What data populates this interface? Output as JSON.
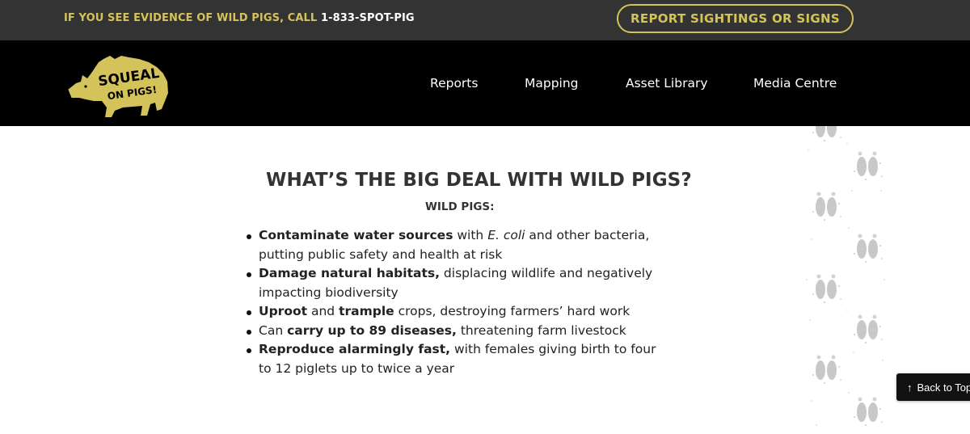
{
  "colors": {
    "accent": "#d4c35a",
    "topbar_bg": "#333333",
    "nav_bg": "#000000"
  },
  "topbar": {
    "alert_text": "IF YOU SEE EVIDENCE OF WILD PIGS, CALL ",
    "phone": "1-833-SPOT-PIG",
    "report_button": "REPORT SIGHTINGS OR SIGNS"
  },
  "logo": {
    "line1": "SQUEAL",
    "line2": "ON PIGS!",
    "icon": "pig-logo-icon"
  },
  "nav": {
    "reports": "Reports",
    "mapping": "Mapping",
    "asset_library": "Asset Library",
    "media_centre": "Media Centre"
  },
  "main": {
    "headline": "WHAT’S THE BIG DEAL WITH WILD PIGS?",
    "subhead": "WILD PIGS:",
    "facts": [
      {
        "b1": "Contaminate water sources",
        "t1": " with ",
        "i1": "E. coli",
        "t2": " and other bacteria, putting public safety and health at risk"
      },
      {
        "b1": "Damage natural habitats,",
        "t1": " displacing wildlife and negatively impacting biodiversity"
      },
      {
        "b1": "Uproot",
        "t1": " and ",
        "b2": "trample",
        "t2": " crops, destroying farmers’ hard work"
      },
      {
        "t1": "Can ",
        "b1": "carry up to 89 diseases,",
        "t2": " threatening farm livestock"
      },
      {
        "b1": "Reproduce alarmingly fast,",
        "t1": " with females giving birth to four to 12 piglets up to twice a year"
      }
    ]
  },
  "back_to_top": {
    "arrow": "↑",
    "label": "Back to Top"
  },
  "decor": {
    "icon": "pig-tracks-icon"
  }
}
